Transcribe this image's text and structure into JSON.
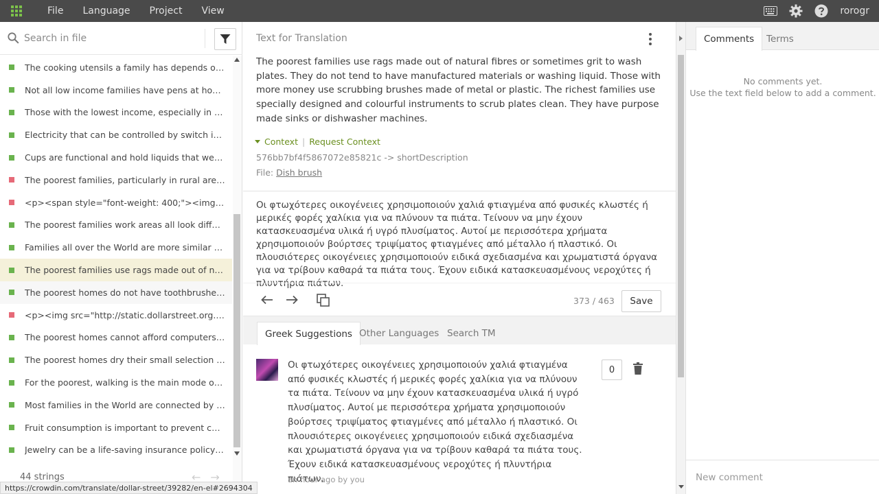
{
  "topbar": {
    "menu": [
      "File",
      "Language",
      "Project",
      "View"
    ],
    "user": "rorogr"
  },
  "left": {
    "search_placeholder": "Search in file",
    "items": [
      {
        "text": "The cooking utensils a family has depends on economic",
        "status": "green"
      },
      {
        "text": "Not all low income families have pens at home, since",
        "status": "green"
      },
      {
        "text": "Those with the lowest income, especially in rural areas",
        "status": "green"
      },
      {
        "text": "Electricity that can be controlled by switch is convenient",
        "status": "green"
      },
      {
        "text": "Cups are functional and hold liquids that we drink",
        "status": "green"
      },
      {
        "text": "The poorest families, particularly in rural areas, prepare",
        "status": "red"
      },
      {
        "text": "<p><span style=\"font-weight: 400;\"><img src=\"http://static",
        "status": "red"
      },
      {
        "text": "The poorest families work areas all look different from",
        "status": "green"
      },
      {
        "text": "Families all over the World are more similar than you think",
        "status": "green"
      },
      {
        "text": "The poorest families use rags made out of natural fibres",
        "status": "green"
      },
      {
        "text": "The poorest homes do not have toothbrushes, but use",
        "status": "green"
      },
      {
        "text": "<p><img src=\"http://static.dollarstreet.org.s3.amazonaws",
        "status": "red"
      },
      {
        "text": "The poorest homes cannot afford computers or internet",
        "status": "green"
      },
      {
        "text": "The poorest homes dry their small selection of meat",
        "status": "green"
      },
      {
        "text": "For the poorest, walking is the main mode of transport",
        "status": "green"
      },
      {
        "text": "Most families in the World are connected by mobile phones",
        "status": "green"
      },
      {
        "text": "Fruit consumption is important to prevent chronic disease",
        "status": "green"
      },
      {
        "text": "Jewelry can be a life-saving insurance policy because",
        "status": "green"
      }
    ],
    "strings_count": "44 strings"
  },
  "center": {
    "title": "Text for Translation",
    "source": "The poorest families use rags made out of natural fibres or sometimes grit to wash plates. They do not tend to have manufactured materials or washing liquid. Those with more money use scrubbing brushes made of metal or plastic. The richest families use specially designed and colourful instruments to scrub plates clean. They have purpose made sinks or dishwasher machines.",
    "context_label": "Context",
    "request_context": "Request Context",
    "key": "576bb7bf4f5867072e85821c -> shortDescription",
    "file_label": "File:",
    "file_name": "Dish brush",
    "translation": "Οι φτωχότερες οικογένειες χρησιμοποιούν χαλιά φτιαγμένα από φυσικές κλωστές ή μερικές φορές χαλίκια για να πλύνουν τα πιάτα. Τείνουν να μην έχουν κατασκευασμένα υλικά ή υγρό πλυσίματος. Αυτοί με περισσότερα χρήματα χρησιμοποιούν βούρτσες τριψίματος φτιαγμένες από μέταλλο ή πλαστικό. Οι πλουσιότερες οικογένειες χρησιμοποιούν ειδικά σχεδιασμένα και χρωματιστά όργανα για να τρίβουν καθαρά τα πιάτα τους. Έχουν ειδικά κατασκευασμένους νεροχύτες ή πλυντήρια πιάτων.",
    "counter": "373 / 463",
    "save_label": "Save",
    "tabs": [
      "Greek Suggestions",
      "Other Languages",
      "Search TM"
    ],
    "suggestion": {
      "text": "Οι φτωχότερες οικογένειες χρησιμοποιούν χαλιά φτιαγμένα από φυσικές κλωστές ή μερικές φορές χαλίκια για να πλύνουν τα πιάτα. Τείνουν να μην έχουν κατασκευασμένα υλικά ή υγρό πλυσίματος. Αυτοί με περισσότερα χρήματα χρησιμοποιούν βούρτσες τριψίματος φτιαγμένες από μέταλλο ή πλαστικό. Οι πλουσιότερες οικογένειες χρησιμοποιούν ειδικά σχεδιασμένα και χρωματιστά όργανα για να τρίβουν καθαρά τα πιάτα τους. Έχουν ειδικά κατασκευασμένους νεροχύτες ή πλυντήρια πιάτων.",
      "votes": "0",
      "meta": "an hour ago by you"
    }
  },
  "right": {
    "tabs": [
      "Comments",
      "Terms"
    ],
    "empty_line1": "No comments yet.",
    "empty_line2": "Use the text field below to add a comment.",
    "new_comment_placeholder": "New comment"
  },
  "status_url": "https://crowdin.com/translate/dollar-street/39282/en-el#2694304",
  "colors": {
    "accent_green": "#6a8f1f",
    "status_green": "#6ab34e",
    "status_red": "#e66a78",
    "topbar": "#4a4a4a"
  }
}
